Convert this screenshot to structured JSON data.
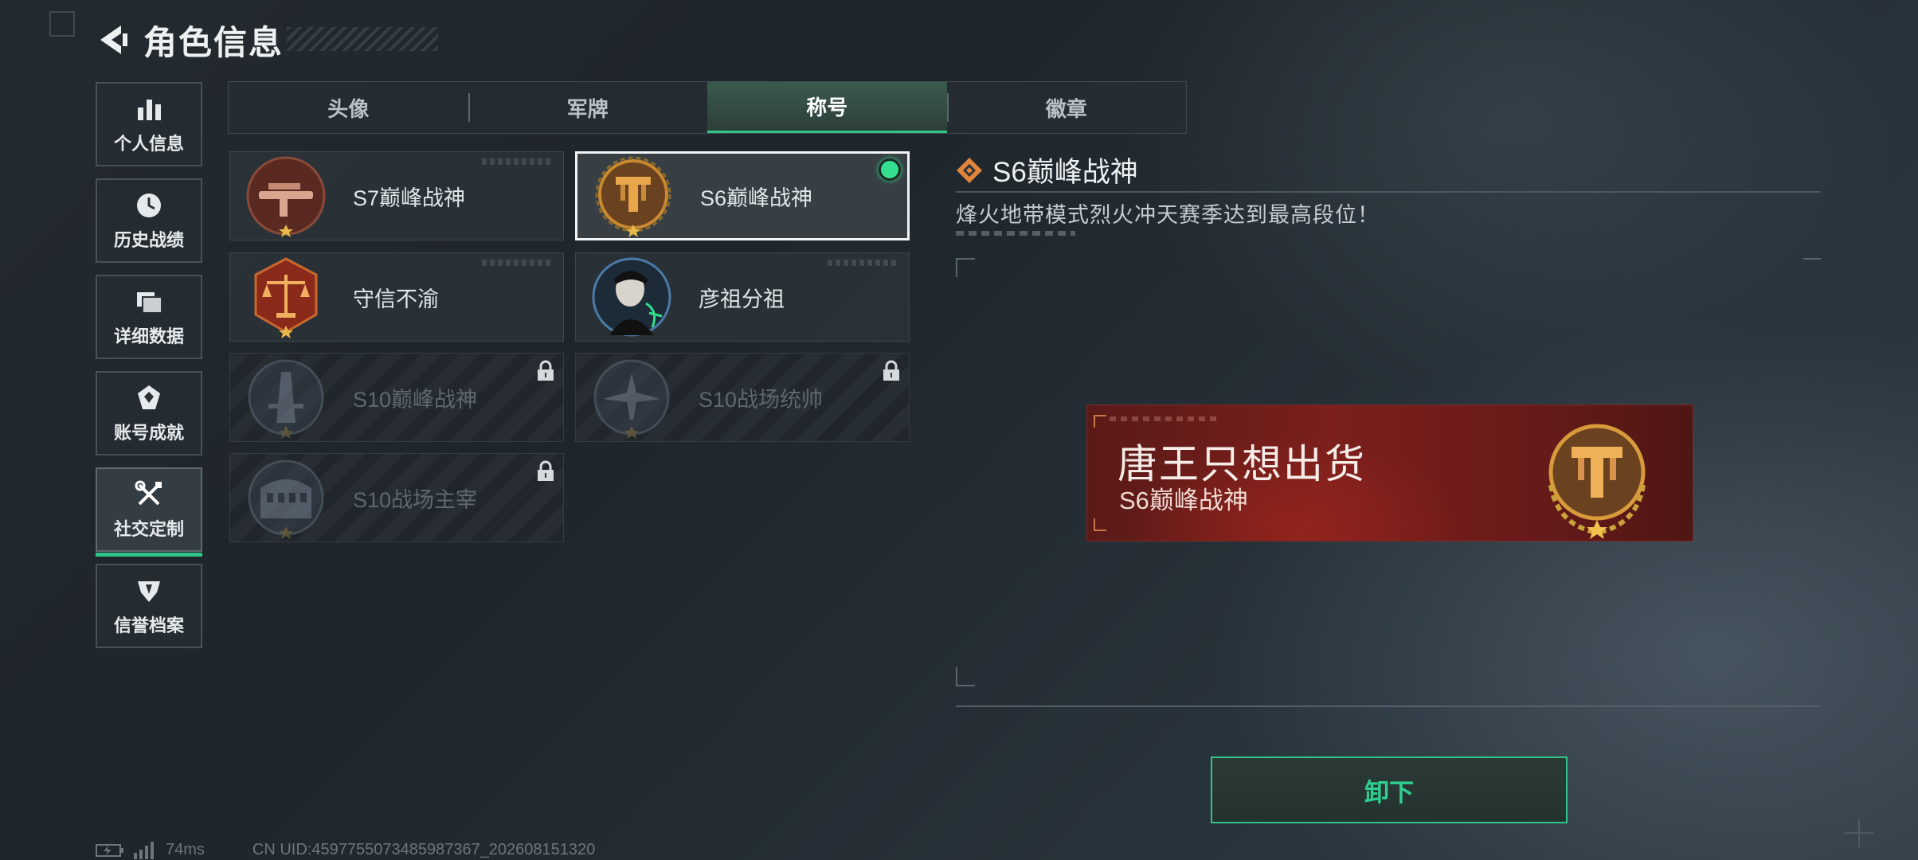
{
  "header": {
    "title": "角色信息"
  },
  "sidebar": {
    "items": [
      {
        "label": "个人信息",
        "icon": "bar-chart-icon"
      },
      {
        "label": "历史战绩",
        "icon": "clock-icon"
      },
      {
        "label": "详细数据",
        "icon": "folders-icon"
      },
      {
        "label": "账号成就",
        "icon": "achievement-icon"
      },
      {
        "label": "社交定制",
        "icon": "tools-icon",
        "active": true
      },
      {
        "label": "信誉档案",
        "icon": "credit-shield-icon"
      }
    ]
  },
  "tabs": [
    {
      "label": "头像"
    },
    {
      "label": "军牌"
    },
    {
      "label": "称号",
      "active": true
    },
    {
      "label": "徽章"
    }
  ],
  "titles": [
    {
      "name": "S7巅峰战神",
      "icon": "crossbow-emblem-icon",
      "locked": false
    },
    {
      "name": "S6巅峰战神",
      "icon": "gold-t-emblem-icon",
      "locked": false,
      "selected": true
    },
    {
      "name": "守信不渝",
      "icon": "scales-emblem-icon",
      "locked": false
    },
    {
      "name": "彦祖分祖",
      "icon": "portrait-emblem-icon",
      "locked": false
    },
    {
      "name": "S10巅峰战神",
      "icon": "tower-emblem-icon",
      "locked": true
    },
    {
      "name": "S10战场统帅",
      "icon": "aircraft-emblem-icon",
      "locked": true
    },
    {
      "name": "S10战场主宰",
      "icon": "colosseum-emblem-icon",
      "locked": true
    }
  ],
  "detail": {
    "title": "S6巅峰战神",
    "description": "烽火地带模式烈火冲天赛季达到最高段位！"
  },
  "banner": {
    "player_name": "唐王只想出货",
    "title": "S6巅峰战神"
  },
  "unequip_button": {
    "label": "卸下"
  },
  "status": {
    "ping": "74ms",
    "uid": "CN UID:4597755073485987367_202608151320"
  },
  "colors": {
    "accent": "#2fc488",
    "banner": "#7a1f1c",
    "gold": "#c9892e"
  }
}
